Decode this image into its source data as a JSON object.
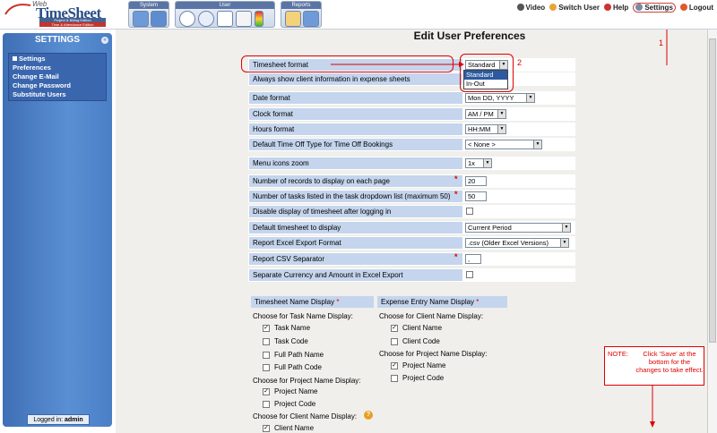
{
  "app": {
    "web": "Web",
    "name": "TimeSheet",
    "edition1": "Project & Billing Edition",
    "edition2": "Time & Attendance Edition"
  },
  "toolbar": {
    "system": "System",
    "user": "User",
    "reports": "Reports"
  },
  "nav": {
    "video": "Video",
    "switch_user": "Switch User",
    "help": "Help",
    "settings": "Settings",
    "logout": "Logout"
  },
  "sidebar": {
    "title": "SETTINGS",
    "section": "Settings",
    "items": [
      {
        "label": "Preferences"
      },
      {
        "label": "Change E-Mail"
      },
      {
        "label": "Change Password"
      },
      {
        "label": "Substitute Users"
      }
    ],
    "logged_in_label": "Logged in:",
    "logged_in_user": "admin"
  },
  "page": {
    "title": "Edit User Preferences"
  },
  "prefs": {
    "timesheet_format": {
      "label": "Timesheet format",
      "value": "Standard",
      "options": [
        "Standard",
        "In-Out"
      ]
    },
    "client_info": {
      "label": "Always show client information in expense sheets"
    },
    "date_format": {
      "label": "Date format",
      "value": "Mon DD, YYYY"
    },
    "clock_format": {
      "label": "Clock format",
      "value": "AM / PM"
    },
    "hours_format": {
      "label": "Hours format",
      "value": "HH:MM"
    },
    "time_off": {
      "label": "Default Time Off Type for Time Off Bookings",
      "value": "< None >"
    },
    "menu_zoom": {
      "label": "Menu icons zoom",
      "value": "1x"
    },
    "records": {
      "label": "Number of records to display on each page",
      "value": "20"
    },
    "tasks": {
      "label": "Number of tasks listed in the task dropdown list (maximum 50)",
      "value": "50"
    },
    "disable_display": {
      "label": "Disable display of timesheet after logging in"
    },
    "default_ts": {
      "label": "Default timesheet to display",
      "value": "Current Period"
    },
    "excel_format": {
      "label": "Report Excel Export Format",
      "value": ".csv (Older Excel Versions)"
    },
    "csv_sep": {
      "label": "Report CSV Separator",
      "value": ","
    },
    "separate_currency": {
      "label": "Separate Currency and Amount in Excel Export"
    }
  },
  "name_display": {
    "ts_header": "Timesheet Name Display",
    "exp_header": "Expense Entry Name Display",
    "ts_task_label": "Choose for Task Name Display:",
    "ts_task_opts": [
      "Task Name",
      "Task Code",
      "Full Path Name",
      "Full Path Code"
    ],
    "ts_task_checked": [
      true,
      false,
      false,
      false
    ],
    "ts_proj_label": "Choose for Project Name Display:",
    "ts_proj_opts": [
      "Project Name",
      "Project Code"
    ],
    "ts_proj_checked": [
      true,
      false
    ],
    "ts_client_label": "Choose for Client Name Display:",
    "ts_client_opts": [
      "Client Name"
    ],
    "exp_client_label": "Choose for Client Name Display:",
    "exp_client_opts": [
      "Client Name",
      "Client Code"
    ],
    "exp_client_checked": [
      true,
      false
    ],
    "exp_proj_label": "Choose for Project Name Display:",
    "exp_proj_opts": [
      "Project Name",
      "Project Code"
    ],
    "exp_proj_checked": [
      true,
      false
    ]
  },
  "annotations": {
    "n1": "1",
    "n2": "2",
    "note_label": "NOTE:",
    "note_text": "Click 'Save' at the bottom for the changes to take effect."
  },
  "colors": {
    "accent": "#d00000",
    "sidebar": "#4a7fc6",
    "row": "#c4d5ed"
  }
}
